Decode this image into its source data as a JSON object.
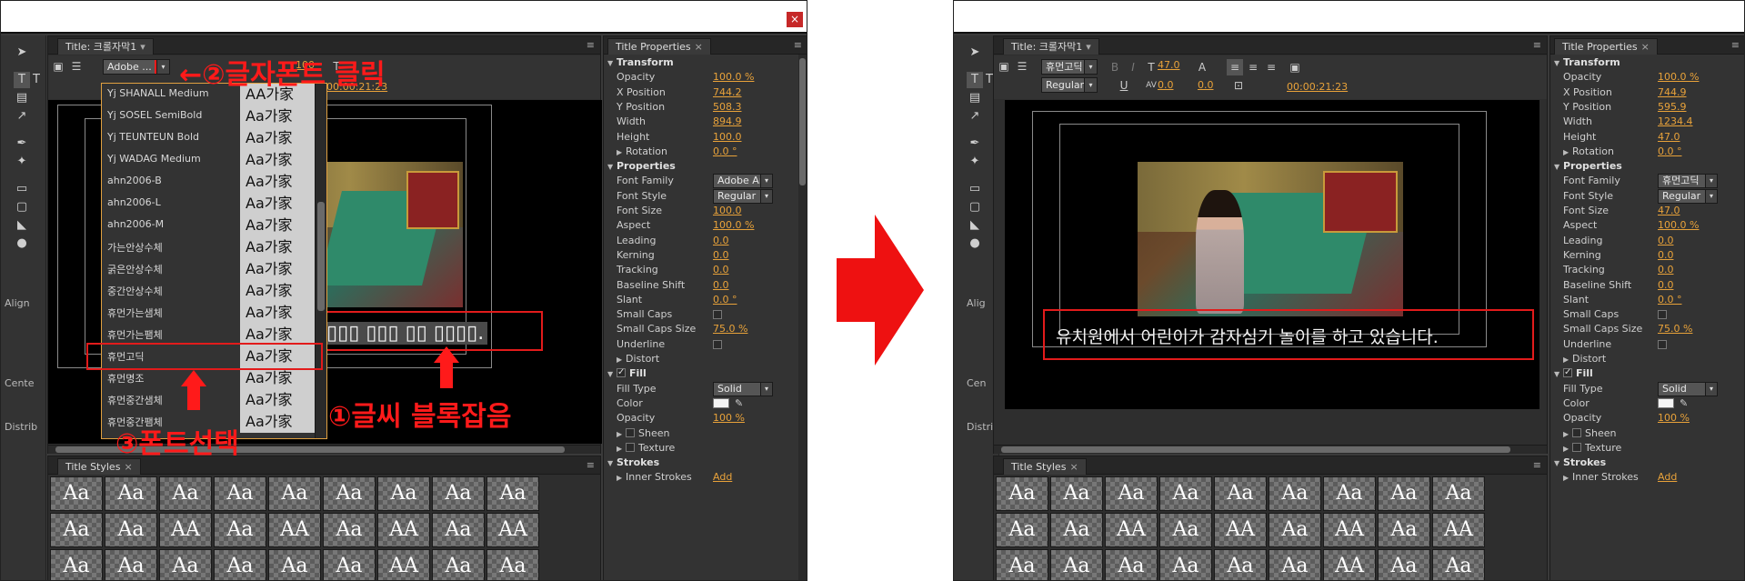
{
  "colors": {
    "accent_red": "#ff1a1a",
    "value_orange": "#e8a23a",
    "panel_bg": "#333333"
  },
  "left": {
    "designer_tab": "Title: 크롤자막1",
    "font_field": "Adobe ...",
    "font_size_value": "100",
    "timecode": "00:00:21:23",
    "annotation_click": "←②글자폰트 클릭",
    "annotation_block": "①글씨 블록잡음",
    "annotation_select": "③폰트선택",
    "subtitle_text": "▯▯▯ ▯▯▯ ▯▯ ▯▯▯▯.",
    "font_list": [
      {
        "name": "Yj SHANALL Medium",
        "preview": "AA가家"
      },
      {
        "name": "Yj SOSEL SemiBold",
        "preview": "Aa가家"
      },
      {
        "name": "Yj TEUNTEUN Bold",
        "preview": "Aa가家"
      },
      {
        "name": "Yj WADAG Medium",
        "preview": "Aa가家"
      },
      {
        "name": "ahn2006-B",
        "preview": "Aa가家"
      },
      {
        "name": "ahn2006-L",
        "preview": "Aa가家"
      },
      {
        "name": "ahn2006-M",
        "preview": "Aa가家"
      },
      {
        "name": "가는안상수체",
        "preview": "Aa가家"
      },
      {
        "name": "굵은안상수체",
        "preview": "Aa가家"
      },
      {
        "name": "중간안상수체",
        "preview": "Aa가家"
      },
      {
        "name": "휴먼가는샘체",
        "preview": "Aa가家"
      },
      {
        "name": "휴먼가는팸체",
        "preview": "Aa가家"
      },
      {
        "name": "휴먼고딕",
        "preview": "Aa가家"
      },
      {
        "name": "휴먼명조",
        "preview": "Aa가家"
      },
      {
        "name": "휴먼중간샘체",
        "preview": "Aa가家"
      },
      {
        "name": "휴먼중간팸체",
        "preview": "Aa가家"
      }
    ],
    "side_labels": {
      "align": "Align",
      "center": "Cente",
      "distribute": "Distrib"
    },
    "styles_tab": "Title Styles",
    "props_tab": "Title Properties",
    "props": {
      "transform": "Transform",
      "opacity": {
        "label": "Opacity",
        "value": "100.0 %"
      },
      "x_position": {
        "label": "X Position",
        "value": "744.2"
      },
      "y_position": {
        "label": "Y Position",
        "value": "508.3"
      },
      "width": {
        "label": "Width",
        "value": "894.9"
      },
      "height": {
        "label": "Height",
        "value": "100.0"
      },
      "rotation": {
        "label": "Rotation",
        "value": "0.0 °"
      },
      "properties": "Properties",
      "font_family": {
        "label": "Font Family",
        "value": "Adobe Ar..."
      },
      "font_style": {
        "label": "Font Style",
        "value": "Regular"
      },
      "font_size": {
        "label": "Font Size",
        "value": "100.0"
      },
      "aspect": {
        "label": "Aspect",
        "value": "100.0 %"
      },
      "leading": {
        "label": "Leading",
        "value": "0.0"
      },
      "kerning": {
        "label": "Kerning",
        "value": "0.0"
      },
      "tracking": {
        "label": "Tracking",
        "value": "0.0"
      },
      "baseline_shift": {
        "label": "Baseline Shift",
        "value": "0.0"
      },
      "slant": {
        "label": "Slant",
        "value": "0.0 °"
      },
      "small_caps": {
        "label": "Small Caps"
      },
      "small_caps_size": {
        "label": "Small Caps Size",
        "value": "75.0 %"
      },
      "underline": {
        "label": "Underline"
      },
      "distort": "Distort",
      "fill": "Fill",
      "fill_type": {
        "label": "Fill Type",
        "value": "Solid"
      },
      "color": {
        "label": "Color"
      },
      "fill_opacity": {
        "label": "Opacity",
        "value": "100 %"
      },
      "sheen": "Sheen",
      "texture": "Texture",
      "strokes": "Strokes",
      "inner_strokes": {
        "label": "Inner Strokes",
        "value": "Add"
      }
    }
  },
  "right": {
    "designer_tab": "Title: 크롤자막1",
    "font_field": "휴먼고딕",
    "style_field": "Regular",
    "font_size_value": "47.0",
    "leading_value": "0.0",
    "kerning_value": "0.0",
    "timecode": "00:00:21:23",
    "subtitle_text": "유치원에서 어린이가 감자심기 놀이를 하고 있습니다.",
    "side_labels": {
      "align": "Alig",
      "center": "Cen",
      "distribute": "Distri"
    },
    "styles_tab": "Title Styles",
    "props_tab": "Title Properties",
    "props": {
      "transform": "Transform",
      "opacity": {
        "label": "Opacity",
        "value": "100.0 %"
      },
      "x_position": {
        "label": "X Position",
        "value": "744.9"
      },
      "y_position": {
        "label": "Y Position",
        "value": "595.9"
      },
      "width": {
        "label": "Width",
        "value": "1234.4"
      },
      "height": {
        "label": "Height",
        "value": "47.0"
      },
      "rotation": {
        "label": "Rotation",
        "value": "0.0 °"
      },
      "properties": "Properties",
      "font_family": {
        "label": "Font Family",
        "value": "휴먼고딕"
      },
      "font_style": {
        "label": "Font Style",
        "value": "Regular"
      },
      "font_size": {
        "label": "Font Size",
        "value": "47.0"
      },
      "aspect": {
        "label": "Aspect",
        "value": "100.0 %"
      },
      "leading": {
        "label": "Leading",
        "value": "0.0"
      },
      "kerning": {
        "label": "Kerning",
        "value": "0.0"
      },
      "tracking": {
        "label": "Tracking",
        "value": "0.0"
      },
      "baseline_shift": {
        "label": "Baseline Shift",
        "value": "0.0"
      },
      "slant": {
        "label": "Slant",
        "value": "0.0 °"
      },
      "small_caps": {
        "label": "Small Caps"
      },
      "small_caps_size": {
        "label": "Small Caps Size",
        "value": "75.0 %"
      },
      "underline": {
        "label": "Underline"
      },
      "distort": "Distort",
      "fill": "Fill",
      "fill_type": {
        "label": "Fill Type",
        "value": "Solid"
      },
      "color": {
        "label": "Color"
      },
      "fill_opacity": {
        "label": "Opacity",
        "value": "100 %"
      },
      "sheen": "Sheen",
      "texture": "Texture",
      "strokes": "Strokes",
      "inner_strokes": {
        "label": "Inner Strokes",
        "value": "Add"
      }
    }
  },
  "styles_swatches": [
    "Aa",
    "Aa",
    "Aa",
    "Aa",
    "Aa",
    "Aa",
    "Aa",
    "Aa",
    "Aa",
    "Aa",
    "Aa",
    "AA",
    "Aa",
    "AA",
    "Aa",
    "AA",
    "Aa",
    "AA",
    "Aa",
    "Aa",
    "Aa",
    "Aa",
    "Aa",
    "Aa",
    "AA",
    "Aa",
    "Aa"
  ],
  "icons": {
    "close": "×",
    "arrow": "▸",
    "type": "T",
    "menu": "≡",
    "dropdown": "▾",
    "pen": "✒",
    "rect": "▭",
    "ellipse": "●",
    "wedge": "◣"
  }
}
